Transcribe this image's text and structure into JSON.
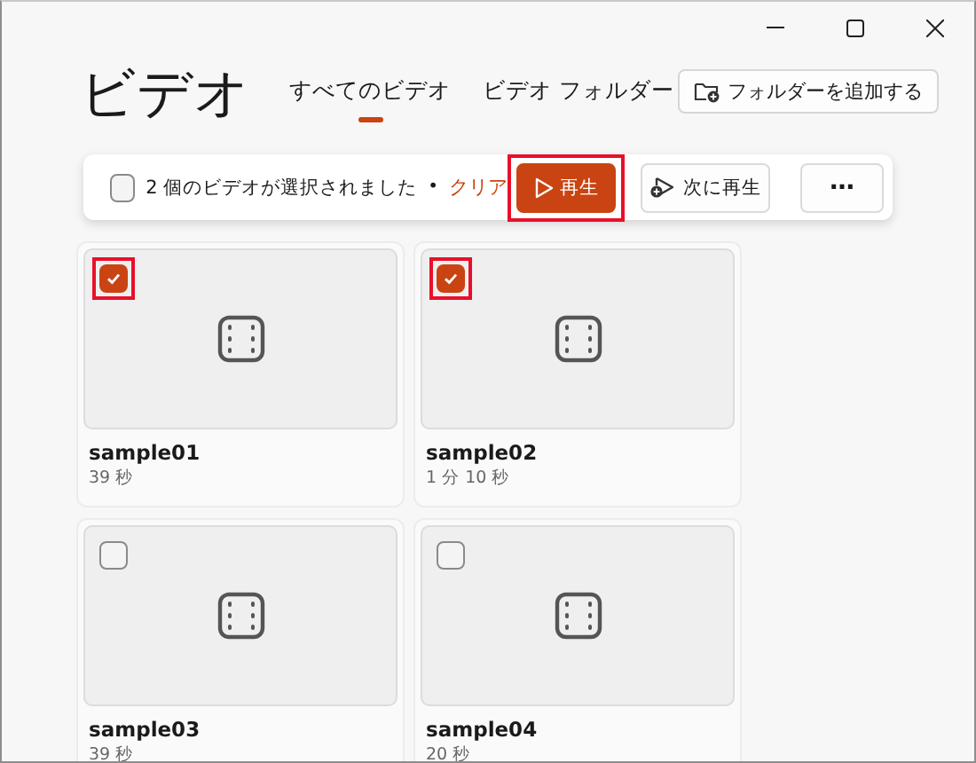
{
  "app": {
    "title": "ビデオ"
  },
  "tabs": [
    {
      "label": "すべてのビデオ",
      "selected": true
    },
    {
      "label": "ビデオ フォルダー",
      "selected": false
    }
  ],
  "add_folder_button": {
    "label": "フォルダーを追加する"
  },
  "selection_bar": {
    "checked": false,
    "message": "2 個のビデオが選択されました",
    "separator": "•",
    "clear_link": "クリア",
    "buttons": [
      {
        "kind": "play",
        "label": "再生",
        "highlighted": true
      },
      {
        "kind": "play_next",
        "label": "次に再生",
        "highlighted": false
      },
      {
        "kind": "more",
        "label": "⋯",
        "highlighted": false
      }
    ]
  },
  "videos": [
    {
      "name": "sample01",
      "duration": "39 秒",
      "selected": true,
      "highlighted": true
    },
    {
      "name": "sample02",
      "duration": "1 分 10 秒",
      "selected": true,
      "highlighted": true
    },
    {
      "name": "sample03",
      "duration": "39 秒",
      "selected": false,
      "highlighted": false
    },
    {
      "name": "sample04",
      "duration": "20 秒",
      "selected": false,
      "highlighted": false
    }
  ]
}
